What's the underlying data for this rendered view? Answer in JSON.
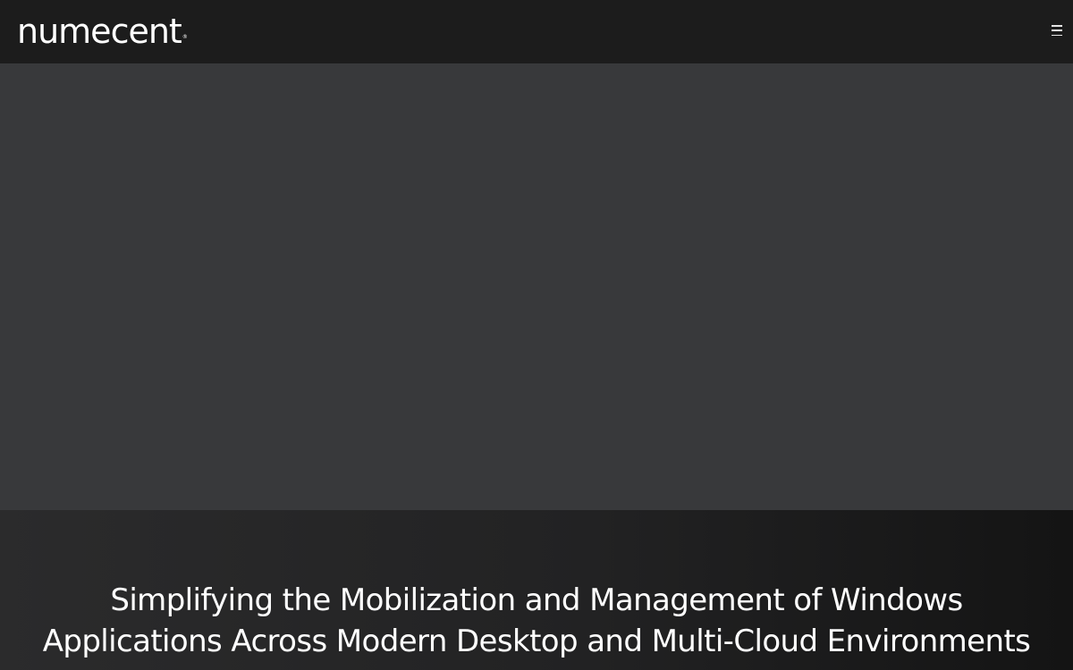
{
  "header": {
    "logo_text": "numecent",
    "logo_mark": "®",
    "menu_icon": "hamburger-menu-icon"
  },
  "media": {
    "content": ""
  },
  "hero": {
    "title_line_1": "Simplifying the Mobilization and Management of Windows",
    "title_line_2": "Applications Across Modern Desktop and Multi-Cloud Environments"
  },
  "colors": {
    "header_bg": "#1c1c1c",
    "media_bg": "#38393b",
    "hero_bg_start": "#2b2b2c",
    "hero_bg_end": "#141414",
    "text": "#ffffff"
  }
}
